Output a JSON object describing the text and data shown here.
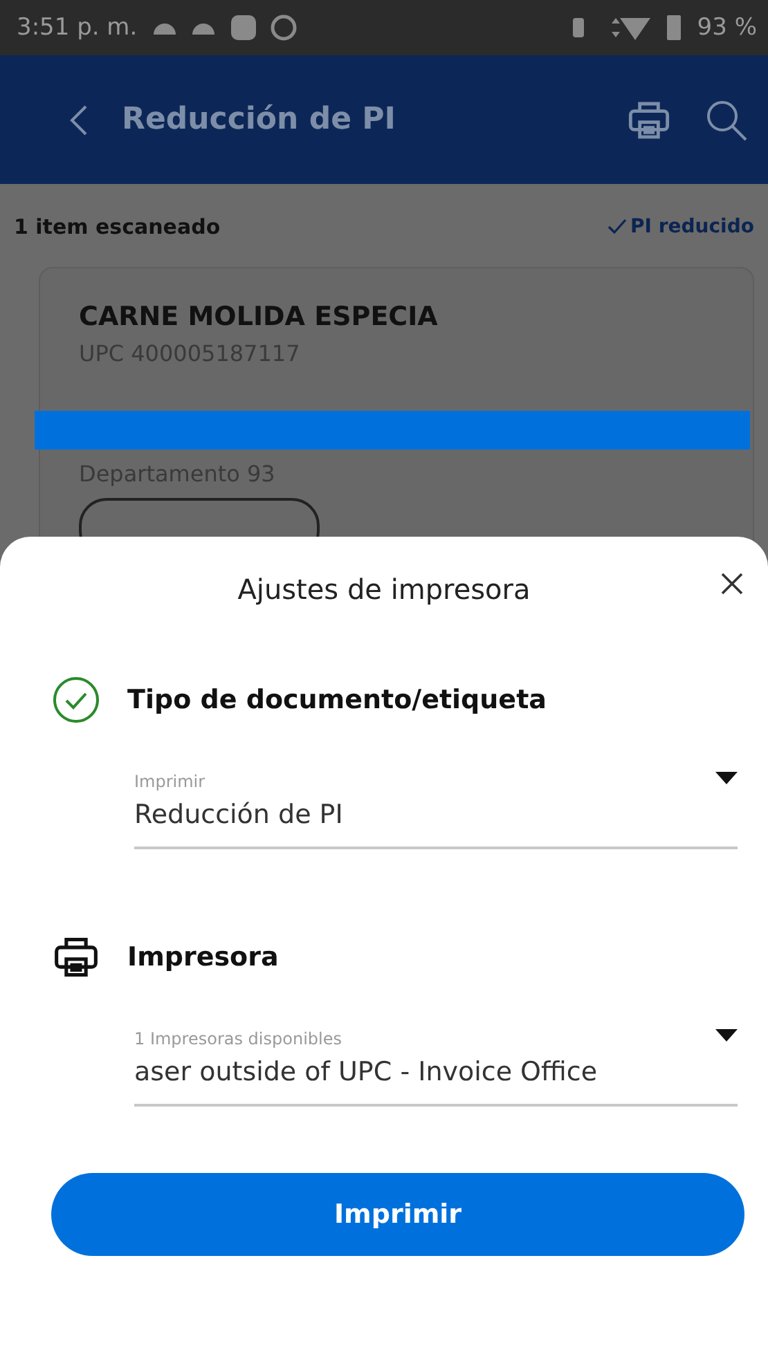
{
  "status_bar": {
    "time": "3:51 p. m.",
    "battery": "93 %"
  },
  "app_bar": {
    "title": "Reducción de PI"
  },
  "summary": {
    "count": "1 item escaneado",
    "status": "PI reducido"
  },
  "item": {
    "name": "CARNE MOLIDA ESPECIA",
    "upc": "UPC 400005187117",
    "department": "Departamento  93"
  },
  "sheet": {
    "title": "Ajustes de impresora",
    "sections": [
      {
        "kind": "done",
        "title": "Tipo de documento/etiqueta",
        "field": {
          "label": "Imprimir",
          "value": "Reducción de PI"
        }
      },
      {
        "kind": "printer",
        "title": "Impresora",
        "field": {
          "label": "1 Impresoras disponibles",
          "value": "aser outside of UPC - Invoice Office"
        }
      }
    ],
    "button": "Imprimir"
  }
}
